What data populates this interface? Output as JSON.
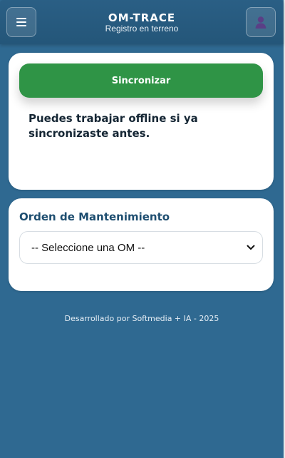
{
  "header": {
    "title": "OM-TRACE",
    "subtitle": "Registro en terreno",
    "menu_icon": "menu-icon",
    "user_icon": "user-icon"
  },
  "sync_card": {
    "sync_button_label": "Sincronizar",
    "offline_message": "Puedes trabajar offline si ya sincronizaste antes."
  },
  "om_card": {
    "title": "Orden de Mantenimiento",
    "select": {
      "selected_value": "-- Seleccione una OM --",
      "icon": "chevron-down-icon"
    }
  },
  "footer": {
    "text": "Desarrollado por Softmedia + IA - 2025"
  },
  "colors": {
    "background": "#2f6991",
    "header": "#245679",
    "accent_green": "#2f9446",
    "section_title": "#1e4e70",
    "user_icon": "#5a3f86"
  }
}
